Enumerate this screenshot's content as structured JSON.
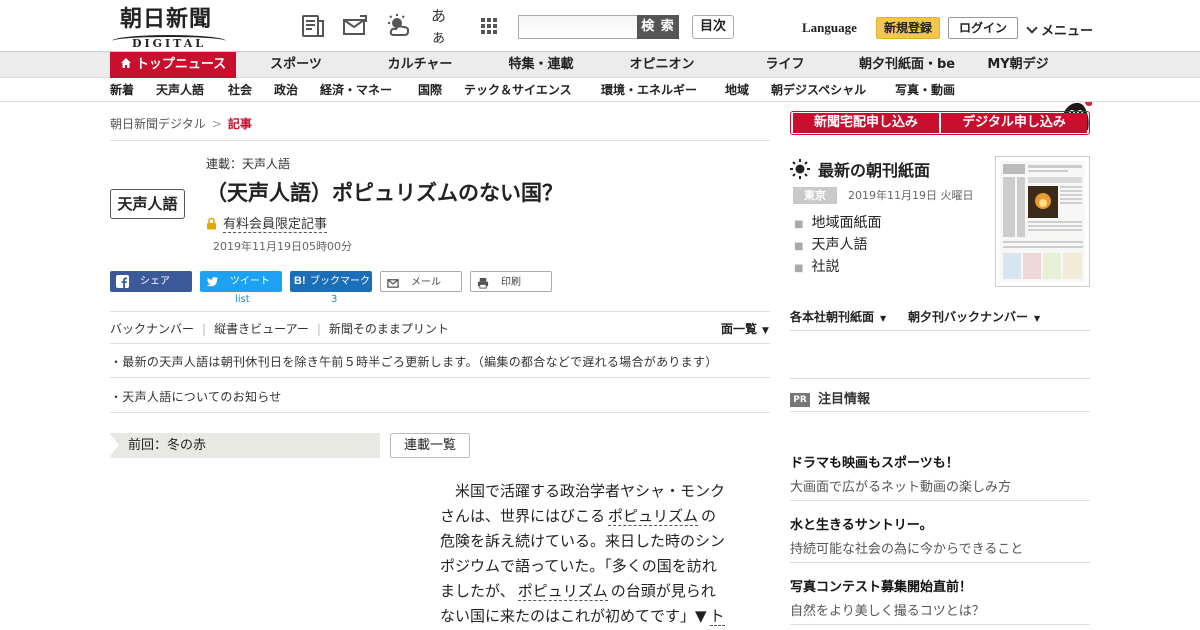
{
  "header": {
    "logo_jp": "朝日新聞",
    "logo_en": "DIGITAL",
    "icons": [
      "newspaper-icon",
      "mail-icon",
      "weather-icon",
      "font-size-icon",
      "grid-menu-icon"
    ],
    "font_size_label": "あぁ",
    "search_button": "検 索",
    "mokuji_button": "目次",
    "language": "Language",
    "register": "新規登録",
    "login": "ログイン",
    "menu": "メニュー"
  },
  "nav1": {
    "items": [
      "トップニュース",
      "スポーツ",
      "カルチャー",
      "特集・連載",
      "オピニオン",
      "ライフ",
      "朝夕刊紙面・be",
      "MY朝デジ"
    ],
    "active_color": "#c8102e"
  },
  "nav2": {
    "items": [
      "新着",
      "天声人語",
      "社会",
      "政治",
      "経済・マネー",
      "国際",
      "テック＆サイエンス",
      "環境・エネルギー",
      "地域",
      "朝デジスペシャル",
      "写真・動画"
    ]
  },
  "breadcrumb": {
    "home": "朝日新聞デジタル",
    "current": "記事"
  },
  "article": {
    "badge": "天声人語",
    "series": "連載：天声人語",
    "title": "（天声人語）ポピュリズムのない国？",
    "member_only": "有料会員限定記事",
    "date": "2019年11月19日05時00分"
  },
  "share": {
    "facebook": "シェア",
    "twitter": "ツイート",
    "twitter_count": "list",
    "hatena": "ブックマーク",
    "hatena_count": "3",
    "mail": "メール",
    "print": "印刷"
  },
  "utility": {
    "backnumber": "バックナンバー",
    "vertical_viewer": "縦書きビューアー",
    "print_as_is": "新聞そのままプリント",
    "men_ichiran": "面一覧"
  },
  "notes": {
    "update": "・最新の天声人語は朝刊休刊日を除き午前５時半ごろ更新します。（編集の都合などで遅れる場合があります）",
    "info": "・天声人語についてのお知らせ"
  },
  "prev": {
    "label": "前回：冬の赤",
    "series_list": "連載一覧"
  },
  "body": {
    "l1": "米国で活躍する政治学者ヤシャ・モンク",
    "l2a": "さんは、世界にはびこる",
    "kw1": "ポピュリズム",
    "l2b": "の",
    "l3": "危険を訴え続けている。来日した時のシン",
    "l4": "ポジウムで語っていた。「多くの国を訪れ",
    "l5a": "ましたが、",
    "kw2": "ポピュリズム",
    "l5b": "の台頭が見られ",
    "l6a": "ない国に来たのはこれが初めてです」▼",
    "l6b": "ト"
  },
  "sidebar": {
    "order_home": "新聞宅配申し込み",
    "order_digital": "デジタル申し込み",
    "chokan_title": "最新の朝刊紙面",
    "region": "東京",
    "paper_date": "2019年11月19日 火曜日",
    "links": [
      "地域面紙面",
      "天声人語",
      "社説"
    ],
    "dropdown1": "各本社朝刊紙面",
    "dropdown2": "朝夕刊バックナンバー",
    "pr_badge": "PR",
    "pr_title": "注目情報",
    "ads": [
      {
        "title": "ドラマも映画もスポーツも！",
        "sub": "大画面で広がるネット動画の楽しみ方"
      },
      {
        "title": "水と生きるサントリー。",
        "sub": "持続可能な社会の為に今からできること"
      },
      {
        "title": "写真コンテスト募集開始直前！",
        "sub": "自然をより美しく撮るコツとは？"
      }
    ]
  }
}
